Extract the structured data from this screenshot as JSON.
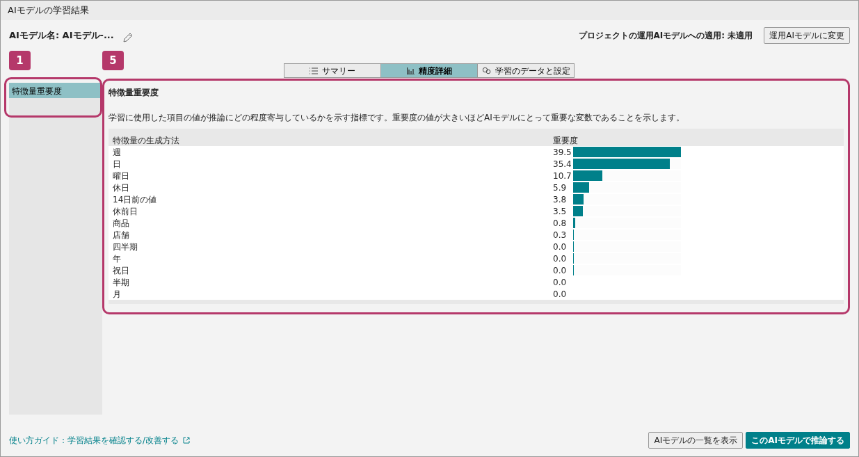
{
  "window": {
    "title": "AIモデルの学習結果"
  },
  "model_name": {
    "label": "AIモデル名:",
    "value": "AIモデル-..."
  },
  "apply_status": {
    "label": "プロジェクトの運用AIモデルへの適用:",
    "value": "未適用"
  },
  "change_button": "運用AIモデルに変更",
  "callouts": [
    {
      "label": "1"
    },
    {
      "label": "5"
    }
  ],
  "tabs": [
    {
      "label": "サマリー",
      "selected": false
    },
    {
      "label": "精度詳細",
      "selected": true
    },
    {
      "label": "学習のデータと設定",
      "selected": false
    }
  ],
  "sidebar": {
    "items": [
      {
        "label": "特徴量重要度",
        "selected": true
      }
    ]
  },
  "panel": {
    "title": "特徴量重要度",
    "description": "学習に使用した項目の値が推論にどの程度寄与しているかを示す指標です。重要度の値が大きいほどAIモデルにとって重要な変数であることを示します。"
  },
  "table": {
    "columns": [
      "特徴量の生成方法",
      "重要度"
    ],
    "rows": [
      {
        "name": "週",
        "value": "39.5",
        "level": 1
      },
      {
        "name": "日",
        "value": "35.4",
        "level": 0.896
      },
      {
        "name": "曜日",
        "value": "10.7",
        "level": 0.271
      },
      {
        "name": "休日",
        "value": "5.9",
        "level": 0.149
      },
      {
        "name": "14日前の値",
        "value": "3.8",
        "level": 0.096
      },
      {
        "name": "休前日",
        "value": "3.5",
        "level": 0.089
      },
      {
        "name": "商品",
        "value": "0.8",
        "level": 0.02
      },
      {
        "name": "店舗",
        "value": "0.3",
        "level": 0.008
      },
      {
        "name": "四半期",
        "value": "0.0",
        "level": 0.005
      },
      {
        "name": "年",
        "value": "0.0",
        "level": 0.005
      },
      {
        "name": "祝日",
        "value": "0.0",
        "level": 0.005
      },
      {
        "name": "半期",
        "value": "0.0"
      },
      {
        "name": "月",
        "value": "0.0"
      }
    ]
  },
  "footer": {
    "guide_link": "使い方ガイド：学習結果を確認する/改善する",
    "buttons": [
      {
        "label": "AIモデルの一覧を表示",
        "kind": "secondary"
      },
      {
        "label": "このAIモデルで推論する",
        "kind": "primary"
      }
    ]
  }
}
